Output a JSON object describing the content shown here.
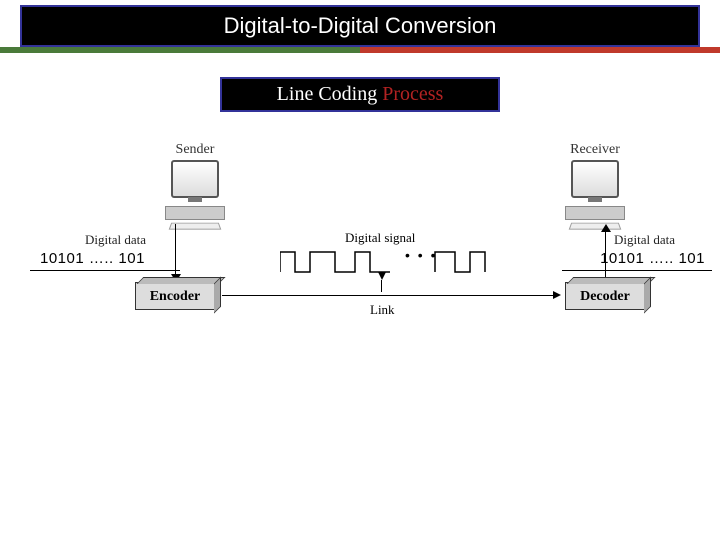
{
  "title": "Digital-to-Digital Conversion",
  "subtitle_prefix": "Line Coding ",
  "subtitle_highlight": "Process",
  "diagram": {
    "sender_label": "Sender",
    "receiver_label": "Receiver",
    "digital_data_label": "Digital data",
    "binary_stream": "10101 ….. 101",
    "digital_signal_label": "Digital signal",
    "encoder_label": "Encoder",
    "decoder_label": "Decoder",
    "link_label": "Link",
    "ellipsis": "• • •"
  }
}
